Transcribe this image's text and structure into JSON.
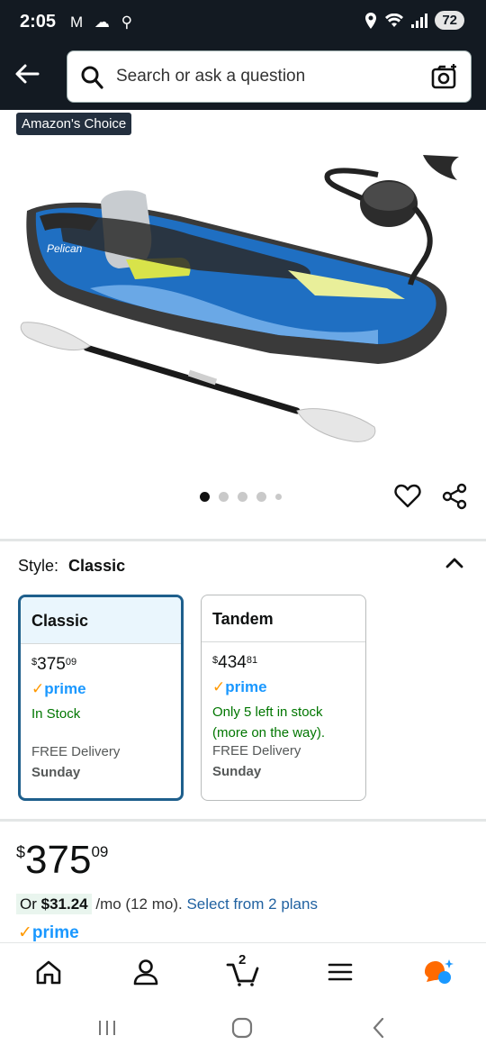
{
  "status_bar": {
    "time": "2:05",
    "left_icons": "M ☁ ⚲",
    "battery": "72"
  },
  "search": {
    "placeholder": "Search or ask a question"
  },
  "product": {
    "badge": "Amazon's Choice",
    "image_count": 5,
    "active_image_index": 0
  },
  "style": {
    "label": "Style:",
    "value": "Classic",
    "options": [
      {
        "name": "Classic",
        "price_whole": "375",
        "price_fraction": "09",
        "currency": "$",
        "prime": "prime",
        "stock": "In Stock",
        "delivery": "FREE Delivery",
        "delivery_day": "Sunday",
        "selected": true
      },
      {
        "name": "Tandem",
        "price_whole": "434",
        "price_fraction": "81",
        "currency": "$",
        "prime": "prime",
        "stock": "Only 5 left in stock (more on the way).",
        "delivery": "FREE Delivery",
        "delivery_day": "Sunday",
        "selected": false
      }
    ]
  },
  "price": {
    "currency": "$",
    "whole": "375",
    "fraction": "09"
  },
  "installment": {
    "prefix": "Or",
    "amount": "$31.24",
    "terms": "/mo (12 mo).",
    "link": "Select from 2 plans"
  },
  "prime_label": "prime",
  "bottom_nav": {
    "cart_count": "2",
    "items": [
      "home-icon",
      "account-icon",
      "cart-icon",
      "menu-icon",
      "rufus-icon"
    ]
  },
  "colors": {
    "header_bg": "#131a22",
    "selected_border": "#1e5f8c",
    "prime_blue": "#1a98ff",
    "stock_green": "#007600",
    "link_blue": "#2162a1"
  }
}
